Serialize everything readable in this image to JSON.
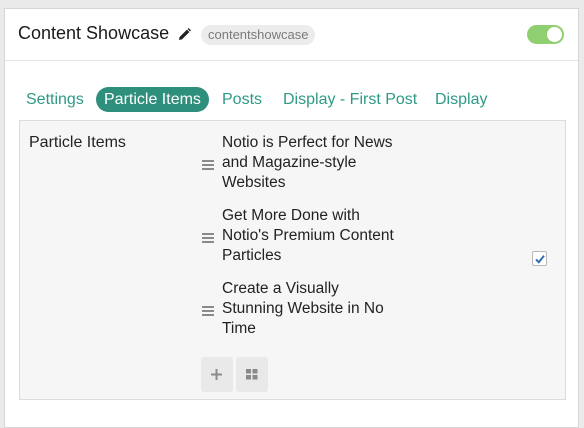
{
  "header": {
    "title": "Content Showcase",
    "slug": "contentshowcase",
    "enabled": true,
    "toggle_color": "#8fcf6f"
  },
  "tabs": [
    {
      "label": "Settings",
      "active": false
    },
    {
      "label": "Particle Items",
      "active": true
    },
    {
      "label": "Posts",
      "active": false
    },
    {
      "label": "Display - First Post",
      "active": false
    },
    {
      "label": "Display",
      "active": false
    }
  ],
  "content": {
    "section_label": "Particle Items",
    "items": [
      {
        "title": "Notio is Perfect for News and Magazine-style Websites"
      },
      {
        "title": "Get More Done with Notio's Premium Content Particles"
      },
      {
        "title": "Create a Visually Stunning Website in No Time"
      }
    ],
    "checkbox_checked": true,
    "buttons": [
      {
        "icon": "plus-icon"
      },
      {
        "icon": "grid-icon"
      }
    ]
  },
  "colors": {
    "accent": "#2e8f7c",
    "tab_text": "#2e9a85"
  }
}
